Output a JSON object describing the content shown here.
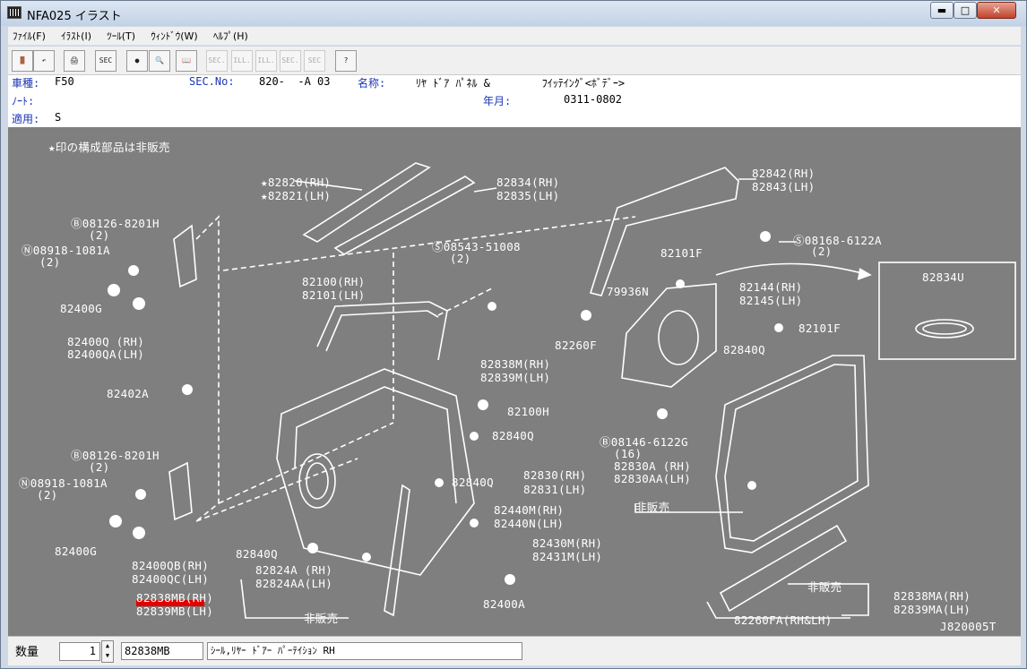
{
  "window": {
    "title": "NFA025 イラスト",
    "min": "▬",
    "max": "□",
    "close": "✕"
  },
  "menu": [
    "ﾌｧｲﾙ(F)",
    "ｲﾗｽﾄ(I)",
    "ﾂｰﾙ(T)",
    "ｳｨﾝﾄﾞｳ(W)",
    "ﾍﾙﾌﾟ(H)"
  ],
  "toolbar": {
    "sec1": "SEC",
    "sec2": "SEC.",
    "ill1": "ILL.",
    "ill2": "ILL.",
    "sec3": "SEC.",
    "sec4": "SEC"
  },
  "info": {
    "model_label": "車種:",
    "model_value": "F50",
    "sec_label": "SEC.No:",
    "sec_value": "820-  -A 03",
    "name_label": "名称:",
    "name_value": "ﾘﾔ ﾄﾞｱ ﾊﾟﾈﾙ &        ﾌｲｯﾃｲﾝｸﾞ<ﾎﾞﾃﾞｰ>",
    "note_label": "ﾉｰﾄ:",
    "year_label": "年月:",
    "year_value": "0311-0802",
    "apply_label": "適用:",
    "apply_value": "S"
  },
  "illustration": {
    "note": "★印の構成部品は非販売",
    "drawing_id": "J820005T",
    "labels": [
      "★82820(RH)",
      "★82821(LH)",
      "82834(RH)",
      "82835(LH)",
      "82842(RH)",
      "82843(LH)",
      "Ⓑ08126-8201H",
      "(2)",
      "Ⓝ08918-1081A",
      "(2)",
      "Ⓢ08543-51008",
      "(2)",
      "Ⓢ08168-6122A",
      "(2)",
      "82101F",
      "82834U",
      "79936N",
      "82144(RH)",
      "82145(LH)",
      "82400G",
      "82100(RH)",
      "82101(LH)",
      "82101F",
      "82260F",
      "82400Q (RH)",
      "82400QA(LH)",
      "82840Q",
      "82838M(RH)",
      "82839M(LH)",
      "82402A",
      "82100H",
      "82840Q",
      "Ⓑ08146-6122G",
      "(16)",
      "Ⓑ08126-8201H",
      "(2)",
      "Ⓝ08918-1081A",
      "(2)",
      "82830(RH)",
      "82831(LH)",
      "82830A (RH)",
      "82830AA(LH)",
      "82840Q",
      "非販売",
      "82440M(RH)",
      "82440N(LH)",
      "82400G",
      "82430M(RH)",
      "82431M(LH)",
      "82840Q",
      "82824A (RH)",
      "82824AA(LH)",
      "82400QB(RH)",
      "82400QC(LH)",
      "82400A",
      "非販売",
      "82838MA(RH)",
      "82839MA(LH)",
      "82838MB(RH)",
      "82839MB(LH)",
      "非販売",
      "82260FA(RH&LH)"
    ]
  },
  "status": {
    "qty_label": "数量",
    "qty_value": "1",
    "part_no": "82838MB",
    "part_desc": "ｼｰﾙ,ﾘﾔｰ ﾄﾞｱｰ ﾊﾟｰﾃｲｼｮﾝ RH"
  },
  "colors": {
    "canvas": "#7f7f7f",
    "highlight": "#e00000",
    "info_label": "#1a35b8"
  }
}
